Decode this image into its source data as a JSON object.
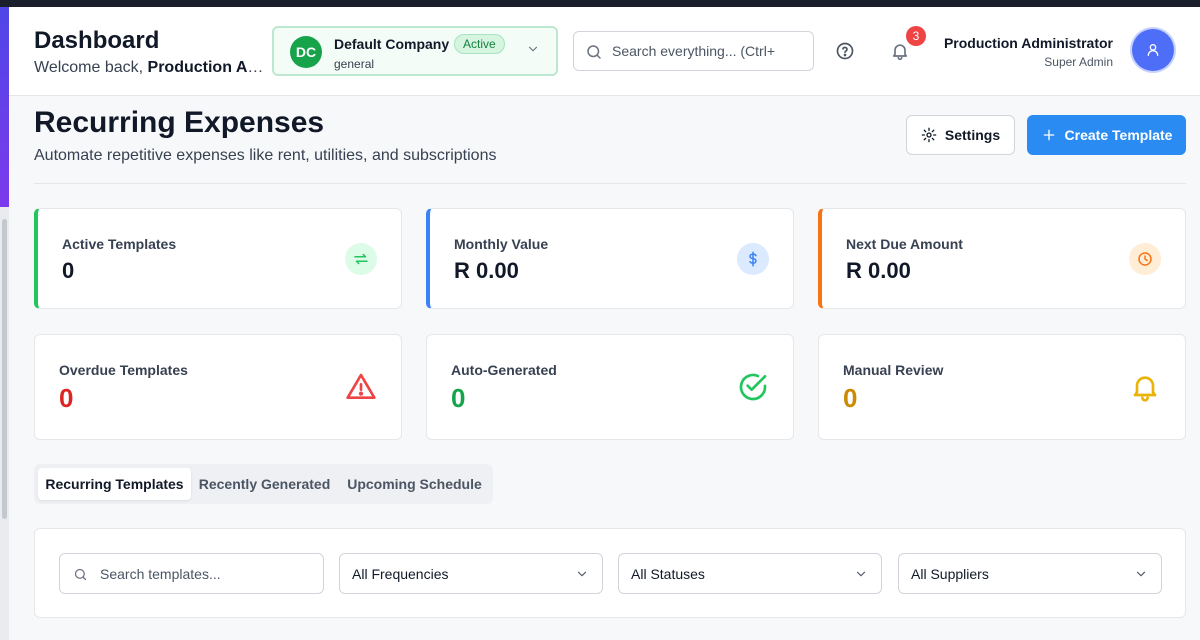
{
  "header": {
    "title": "Dashboard",
    "welcome_prefix": "Welcome back, ",
    "welcome_name": "Production Ad...",
    "company": {
      "initials": "DC",
      "name": "Default Company",
      "status": "Active",
      "subtitle": "general"
    },
    "search_placeholder": "Search everything... (Ctrl+",
    "notification_count": "3",
    "user": {
      "name": "Production Administrator",
      "role": "Super Admin"
    }
  },
  "page": {
    "title": "Recurring Expenses",
    "subtitle": "Automate repetitive expenses like rent, utilities, and subscriptions",
    "settings_label": "Settings",
    "create_label": "Create Template"
  },
  "stats_row1": [
    {
      "label": "Active Templates",
      "value": "0",
      "icon": "repeat-icon",
      "color": "#22c55e"
    },
    {
      "label": "Monthly Value",
      "value": "R 0.00",
      "icon": "dollar-icon",
      "color": "#3b82f6"
    },
    {
      "label": "Next Due Amount",
      "value": "R 0.00",
      "icon": "clock-icon",
      "color": "#f97316"
    }
  ],
  "stats_row2": [
    {
      "label": "Overdue Templates",
      "value": "0",
      "icon": "alert-triangle-icon",
      "color": "#dc2626"
    },
    {
      "label": "Auto-Generated",
      "value": "0",
      "icon": "check-circle-icon",
      "color": "#16a34a"
    },
    {
      "label": "Manual Review",
      "value": "0",
      "icon": "bell-icon",
      "color": "#ca8a04"
    }
  ],
  "tabs": [
    {
      "label": "Recurring Templates",
      "active": true
    },
    {
      "label": "Recently Generated",
      "active": false
    },
    {
      "label": "Upcoming Schedule",
      "active": false
    }
  ],
  "filters": {
    "search_placeholder": "Search templates...",
    "frequency": "All Frequencies",
    "status": "All Statuses",
    "supplier": "All Suppliers"
  },
  "colors": {
    "accent": "#2a8cf2",
    "brand_green": "#16a34a"
  }
}
